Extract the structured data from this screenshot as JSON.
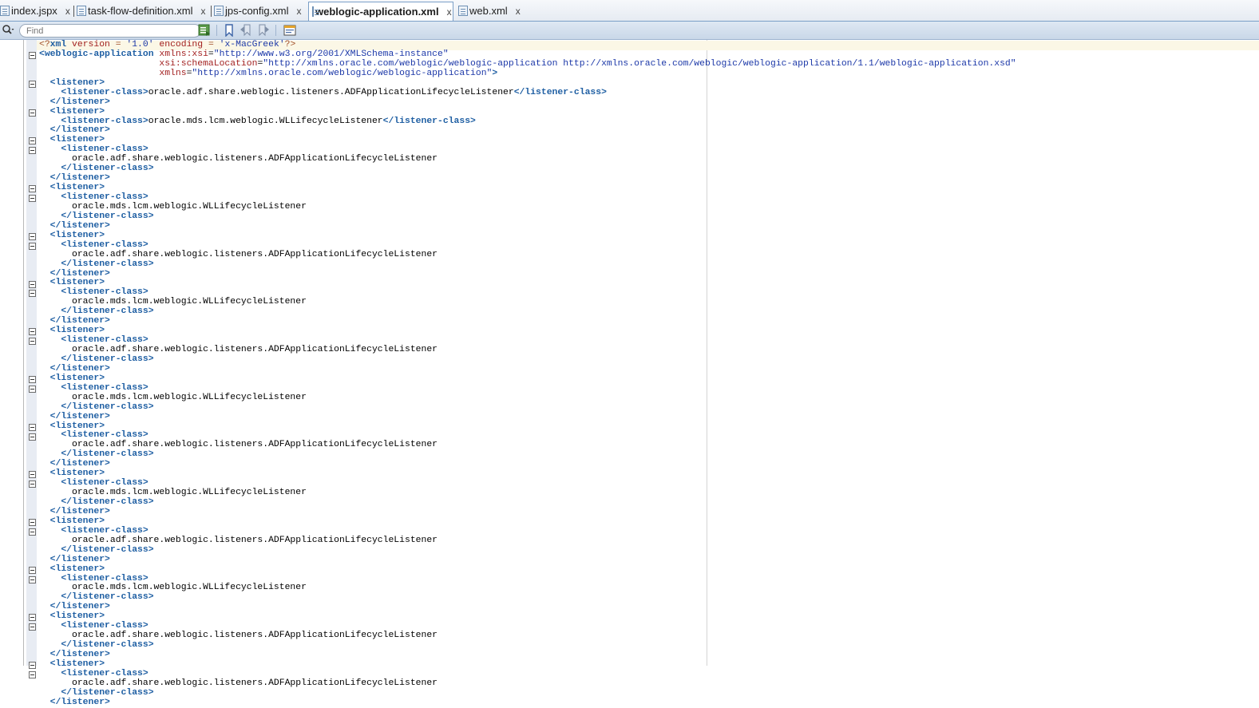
{
  "tabs": [
    {
      "label": "index.jspx",
      "close": "x",
      "active": false
    },
    {
      "label": "task-flow-definition.xml",
      "close": "x",
      "active": false
    },
    {
      "label": "jps-config.xml",
      "close": "x",
      "active": false
    },
    {
      "label": "weblogic-application.xml",
      "close": "x",
      "active": true
    },
    {
      "label": "web.xml",
      "close": "x",
      "active": false
    }
  ],
  "toolbar": {
    "find_placeholder": "Find"
  },
  "colors": {
    "tag": "#1f5fa3",
    "attribute": "#a32121",
    "value": "#1c38a8",
    "declaration": "#a2502a",
    "text": "#000000"
  },
  "editor": {
    "current_line": 1,
    "fold_marker_lines": [
      2,
      5,
      8,
      11,
      12,
      16,
      17,
      21,
      22,
      26,
      27,
      31,
      32,
      36,
      37,
      41,
      42,
      46,
      47,
      51,
      52,
      56,
      57,
      61,
      62,
      66,
      67
    ],
    "lines": [
      [
        [
          "decl",
          "<?"
        ],
        [
          "tag",
          "xml"
        ],
        [
          "attr",
          " version"
        ],
        [
          "decl",
          " = "
        ],
        [
          "val",
          "'1.0'"
        ],
        [
          "attr",
          " encoding"
        ],
        [
          "decl",
          " = "
        ],
        [
          "val",
          "'x-MacGreek'"
        ],
        [
          "decl",
          "?>"
        ]
      ],
      [
        [
          "tag",
          "<weblogic-application"
        ],
        [
          "text",
          " "
        ],
        [
          "attr",
          "xmlns:xsi"
        ],
        [
          "text",
          "="
        ],
        [
          "val",
          "\"http://www.w3.org/2001/XMLSchema-instance\""
        ]
      ],
      [
        [
          "text",
          "                      "
        ],
        [
          "attr",
          "xsi:schemaLocation"
        ],
        [
          "text",
          "="
        ],
        [
          "val",
          "\"http://xmlns.oracle.com/weblogic/weblogic-application http://xmlns.oracle.com/weblogic/weblogic-application/1.1/weblogic-application.xsd\""
        ]
      ],
      [
        [
          "text",
          "                      "
        ],
        [
          "attr",
          "xmlns"
        ],
        [
          "text",
          "="
        ],
        [
          "val",
          "\"http://xmlns.oracle.com/weblogic/weblogic-application\""
        ],
        [
          "tag",
          ">"
        ]
      ],
      [
        [
          "text",
          "  "
        ],
        [
          "tag",
          "<listener>"
        ]
      ],
      [
        [
          "text",
          "    "
        ],
        [
          "tag",
          "<listener-class>"
        ],
        [
          "text",
          "oracle.adf.share.weblogic.listeners.ADFApplicationLifecycleListener"
        ],
        [
          "tag",
          "</listener-class>"
        ]
      ],
      [
        [
          "text",
          "  "
        ],
        [
          "tag",
          "</listener>"
        ]
      ],
      [
        [
          "text",
          "  "
        ],
        [
          "tag",
          "<listener>"
        ]
      ],
      [
        [
          "text",
          "    "
        ],
        [
          "tag",
          "<listener-class>"
        ],
        [
          "text",
          "oracle.mds.lcm.weblogic.WLLifecycleListener"
        ],
        [
          "tag",
          "</listener-class>"
        ]
      ],
      [
        [
          "text",
          "  "
        ],
        [
          "tag",
          "</listener>"
        ]
      ],
      [
        [
          "text",
          "  "
        ],
        [
          "tag",
          "<listener>"
        ]
      ],
      [
        [
          "text",
          "    "
        ],
        [
          "tag",
          "<listener-class>"
        ]
      ],
      [
        [
          "text",
          "      oracle.adf.share.weblogic.listeners.ADFApplicationLifecycleListener"
        ]
      ],
      [
        [
          "text",
          "    "
        ],
        [
          "tag",
          "</listener-class>"
        ]
      ],
      [
        [
          "text",
          "  "
        ],
        [
          "tag",
          "</listener>"
        ]
      ],
      [
        [
          "text",
          "  "
        ],
        [
          "tag",
          "<listener>"
        ]
      ],
      [
        [
          "text",
          "    "
        ],
        [
          "tag",
          "<listener-class>"
        ]
      ],
      [
        [
          "text",
          "      oracle.mds.lcm.weblogic.WLLifecycleListener"
        ]
      ],
      [
        [
          "text",
          "    "
        ],
        [
          "tag",
          "</listener-class>"
        ]
      ],
      [
        [
          "text",
          "  "
        ],
        [
          "tag",
          "</listener>"
        ]
      ],
      [
        [
          "text",
          "  "
        ],
        [
          "tag",
          "<listener>"
        ]
      ],
      [
        [
          "text",
          "    "
        ],
        [
          "tag",
          "<listener-class>"
        ]
      ],
      [
        [
          "text",
          "      oracle.adf.share.weblogic.listeners.ADFApplicationLifecycleListener"
        ]
      ],
      [
        [
          "text",
          "    "
        ],
        [
          "tag",
          "</listener-class>"
        ]
      ],
      [
        [
          "text",
          "  "
        ],
        [
          "tag",
          "</listener>"
        ]
      ],
      [
        [
          "text",
          "  "
        ],
        [
          "tag",
          "<listener>"
        ]
      ],
      [
        [
          "text",
          "    "
        ],
        [
          "tag",
          "<listener-class>"
        ]
      ],
      [
        [
          "text",
          "      oracle.mds.lcm.weblogic.WLLifecycleListener"
        ]
      ],
      [
        [
          "text",
          "    "
        ],
        [
          "tag",
          "</listener-class>"
        ]
      ],
      [
        [
          "text",
          "  "
        ],
        [
          "tag",
          "</listener>"
        ]
      ],
      [
        [
          "text",
          "  "
        ],
        [
          "tag",
          "<listener>"
        ]
      ],
      [
        [
          "text",
          "    "
        ],
        [
          "tag",
          "<listener-class>"
        ]
      ],
      [
        [
          "text",
          "      oracle.adf.share.weblogic.listeners.ADFApplicationLifecycleListener"
        ]
      ],
      [
        [
          "text",
          "    "
        ],
        [
          "tag",
          "</listener-class>"
        ]
      ],
      [
        [
          "text",
          "  "
        ],
        [
          "tag",
          "</listener>"
        ]
      ],
      [
        [
          "text",
          "  "
        ],
        [
          "tag",
          "<listener>"
        ]
      ],
      [
        [
          "text",
          "    "
        ],
        [
          "tag",
          "<listener-class>"
        ]
      ],
      [
        [
          "text",
          "      oracle.mds.lcm.weblogic.WLLifecycleListener"
        ]
      ],
      [
        [
          "text",
          "    "
        ],
        [
          "tag",
          "</listener-class>"
        ]
      ],
      [
        [
          "text",
          "  "
        ],
        [
          "tag",
          "</listener>"
        ]
      ],
      [
        [
          "text",
          "  "
        ],
        [
          "tag",
          "<listener>"
        ]
      ],
      [
        [
          "text",
          "    "
        ],
        [
          "tag",
          "<listener-class>"
        ]
      ],
      [
        [
          "text",
          "      oracle.adf.share.weblogic.listeners.ADFApplicationLifecycleListener"
        ]
      ],
      [
        [
          "text",
          "    "
        ],
        [
          "tag",
          "</listener-class>"
        ]
      ],
      [
        [
          "text",
          "  "
        ],
        [
          "tag",
          "</listener>"
        ]
      ],
      [
        [
          "text",
          "  "
        ],
        [
          "tag",
          "<listener>"
        ]
      ],
      [
        [
          "text",
          "    "
        ],
        [
          "tag",
          "<listener-class>"
        ]
      ],
      [
        [
          "text",
          "      oracle.mds.lcm.weblogic.WLLifecycleListener"
        ]
      ],
      [
        [
          "text",
          "    "
        ],
        [
          "tag",
          "</listener-class>"
        ]
      ],
      [
        [
          "text",
          "  "
        ],
        [
          "tag",
          "</listener>"
        ]
      ],
      [
        [
          "text",
          "  "
        ],
        [
          "tag",
          "<listener>"
        ]
      ],
      [
        [
          "text",
          "    "
        ],
        [
          "tag",
          "<listener-class>"
        ]
      ],
      [
        [
          "text",
          "      oracle.adf.share.weblogic.listeners.ADFApplicationLifecycleListener"
        ]
      ],
      [
        [
          "text",
          "    "
        ],
        [
          "tag",
          "</listener-class>"
        ]
      ],
      [
        [
          "text",
          "  "
        ],
        [
          "tag",
          "</listener>"
        ]
      ],
      [
        [
          "text",
          "  "
        ],
        [
          "tag",
          "<listener>"
        ]
      ],
      [
        [
          "text",
          "    "
        ],
        [
          "tag",
          "<listener-class>"
        ]
      ],
      [
        [
          "text",
          "      oracle.mds.lcm.weblogic.WLLifecycleListener"
        ]
      ],
      [
        [
          "text",
          "    "
        ],
        [
          "tag",
          "</listener-class>"
        ]
      ],
      [
        [
          "text",
          "  "
        ],
        [
          "tag",
          "</listener>"
        ]
      ],
      [
        [
          "text",
          "  "
        ],
        [
          "tag",
          "<listener>"
        ]
      ],
      [
        [
          "text",
          "    "
        ],
        [
          "tag",
          "<listener-class>"
        ]
      ],
      [
        [
          "text",
          "      oracle.adf.share.weblogic.listeners.ADFApplicationLifecycleListener"
        ]
      ],
      [
        [
          "text",
          "    "
        ],
        [
          "tag",
          "</listener-class>"
        ]
      ],
      [
        [
          "text",
          "  "
        ],
        [
          "tag",
          "</listener>"
        ]
      ],
      [
        [
          "text",
          "  "
        ],
        [
          "tag",
          "<listener>"
        ]
      ],
      [
        [
          "text",
          "    "
        ],
        [
          "tag",
          "<listener-class>"
        ]
      ],
      [
        [
          "text",
          "      oracle.adf.share.weblogic.listeners.ADFApplicationLifecycleListener"
        ]
      ],
      [
        [
          "text",
          "    "
        ],
        [
          "tag",
          "</listener-class>"
        ]
      ],
      [
        [
          "text",
          "  "
        ],
        [
          "tag",
          "</listener>"
        ]
      ]
    ]
  }
}
